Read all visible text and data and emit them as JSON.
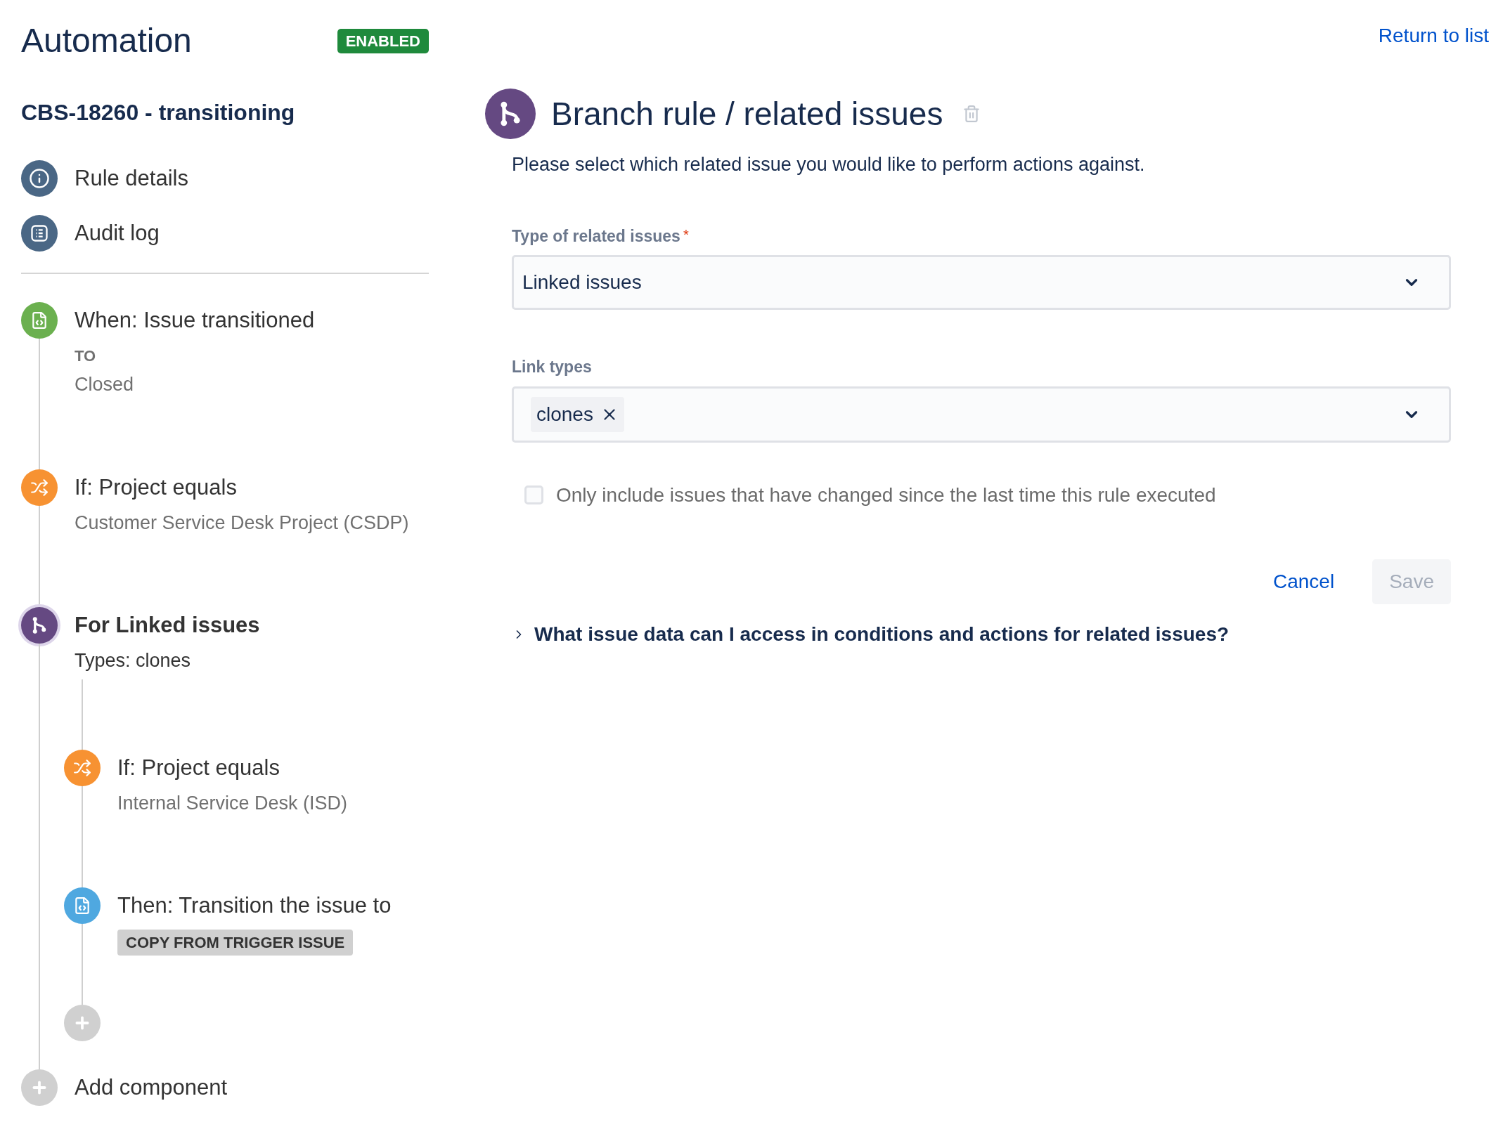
{
  "header": {
    "title": "Automation",
    "status": {
      "label": "ENABLED",
      "kind": "enabled"
    },
    "return_link": "Return to list"
  },
  "rule_name": "CBS-18260 - transitioning",
  "nav": [
    {
      "label": "Rule details",
      "kind": "info"
    },
    {
      "label": "Audit log",
      "kind": "list"
    }
  ],
  "components": [
    {
      "kind": "trigger",
      "title": "When: Issue transitioned",
      "sub_label": "TO",
      "value": "Closed"
    },
    {
      "kind": "condition",
      "title": "If: Project equals",
      "value": "Customer Service Desk Project (CSDP)"
    },
    {
      "kind": "branch",
      "title": "For Linked issues",
      "value": "Types: clones",
      "selected": true,
      "children": [
        {
          "kind": "condition",
          "title": "If: Project equals",
          "value": "Internal Service Desk (ISD)"
        },
        {
          "kind": "action",
          "title": "Then: Transition the issue to",
          "lozenge": "COPY FROM TRIGGER ISSUE"
        },
        {
          "kind": "add"
        }
      ]
    },
    {
      "kind": "add",
      "label": "Add component"
    }
  ],
  "panel": {
    "title": "Branch rule / related issues",
    "description": "Please select which related issue you would like to perform actions against.",
    "fields": [
      {
        "kind": "select",
        "label": "Type of related issues",
        "required_mark": "*",
        "value": "Linked issues"
      },
      {
        "kind": "multiselect",
        "label": "Link types",
        "tags": [
          "clones"
        ]
      }
    ],
    "checkbox": {
      "label": "Only include issues that have changed since the last time this rule executed",
      "checked": false
    },
    "buttons": [
      {
        "kind": "link",
        "label": "Cancel",
        "disabled": false
      },
      {
        "kind": "primary",
        "label": "Save",
        "disabled": true
      }
    ],
    "expander": {
      "label": "What issue data can I access in conditions and actions for related issues?",
      "expanded": false
    }
  }
}
